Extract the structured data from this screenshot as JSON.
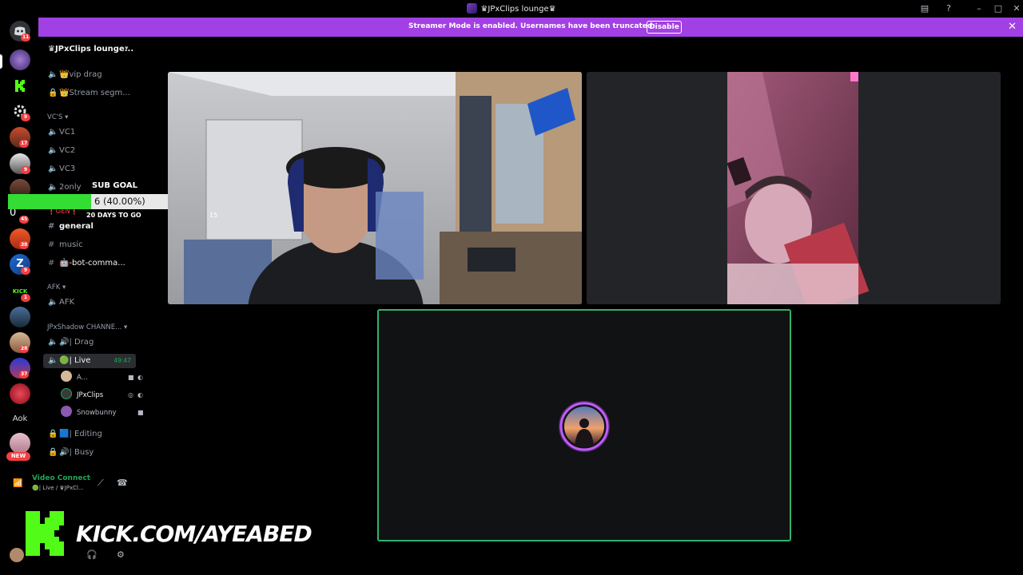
{
  "window": {
    "title": "♛JPxClips lounge♛"
  },
  "banner": {
    "message": "Streamer Mode is enabled. Usernames have been truncated.",
    "disable_label": "Disable"
  },
  "rail": {
    "badges": [
      "11",
      "9",
      "17",
      "9",
      "45",
      "38",
      "9",
      "1",
      "28",
      "37"
    ],
    "text_server": "Aok",
    "new_label": "NEW",
    "kick_server_label": "KICK",
    "zero_label": "0"
  },
  "sidebar": {
    "server_name": "♛JPxClips lounge...",
    "channels_top": [
      {
        "icon": "speaker-icon",
        "label": "👑vip drag"
      },
      {
        "icon": "lock-icon",
        "label": "👑Stream segm..."
      }
    ],
    "cat_vcs": "VC'S",
    "vcs": [
      "VC1",
      "VC2",
      "VC3",
      "2only"
    ],
    "gen_label": "❗GEN❗",
    "text_channels": [
      "general",
      "music",
      "🤖-bot-comma..."
    ],
    "cat_afk": "AFK",
    "afk_channel": "AFK",
    "cat_shadow": "JPxShadow CHANNE...",
    "drag_channel": "🔊| Drag",
    "live_channel": "🟢| Live",
    "live_timer": "49:47",
    "voice_users": [
      "A...",
      "JPxClips",
      "Snowbunny"
    ],
    "editing_channel": "🟦| Editing",
    "busy_channel": "🔊| Busy"
  },
  "subgoal": {
    "title": "SUB GOAL",
    "progress_text": "6 (40.00%)",
    "progress": 0.4,
    "days_left": "20 DAYS TO GO",
    "overlay_number": "15"
  },
  "voice_panel": {
    "status": "Video Connected",
    "location": "🟢| Live / ♛JPxCl..."
  },
  "watermark": {
    "url": "KICK.COM/AYEABED"
  },
  "colors": {
    "banner": "#a140e3",
    "connected_green": "#23a55a",
    "speaking_border": "#2fb36a",
    "kick_green": "#53fc18",
    "goal_green": "#33dd33"
  }
}
